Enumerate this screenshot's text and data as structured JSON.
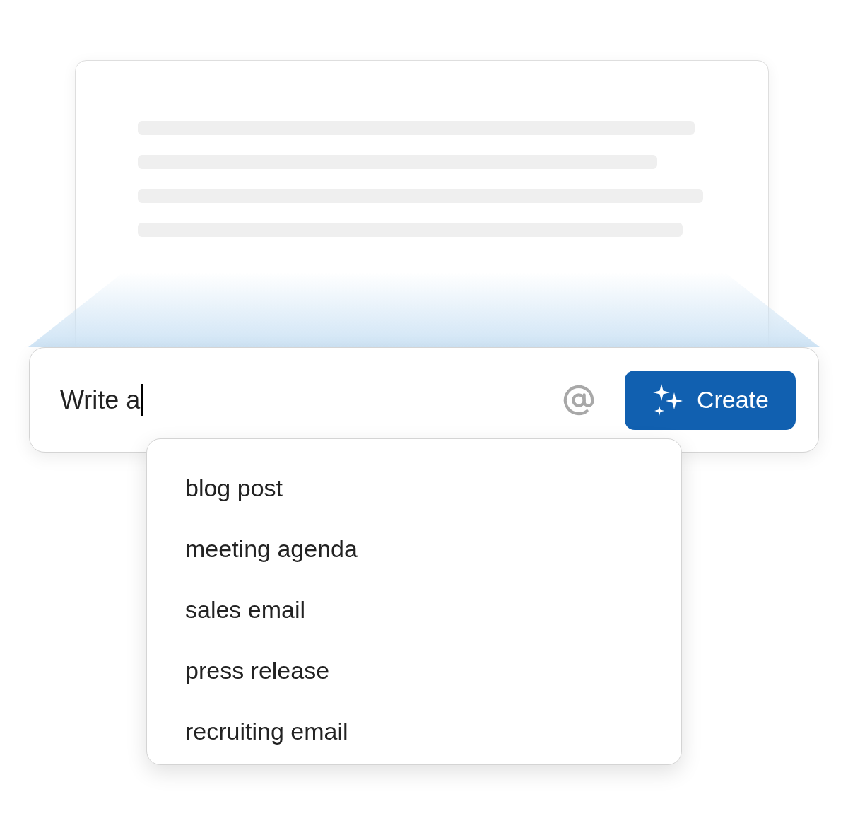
{
  "prompt": {
    "value": "Write a"
  },
  "create_button": {
    "label": "Create"
  },
  "suggestions": [
    {
      "label": "blog post"
    },
    {
      "label": "meeting agenda"
    },
    {
      "label": "sales email"
    },
    {
      "label": "press release"
    },
    {
      "label": "recruiting email"
    }
  ]
}
